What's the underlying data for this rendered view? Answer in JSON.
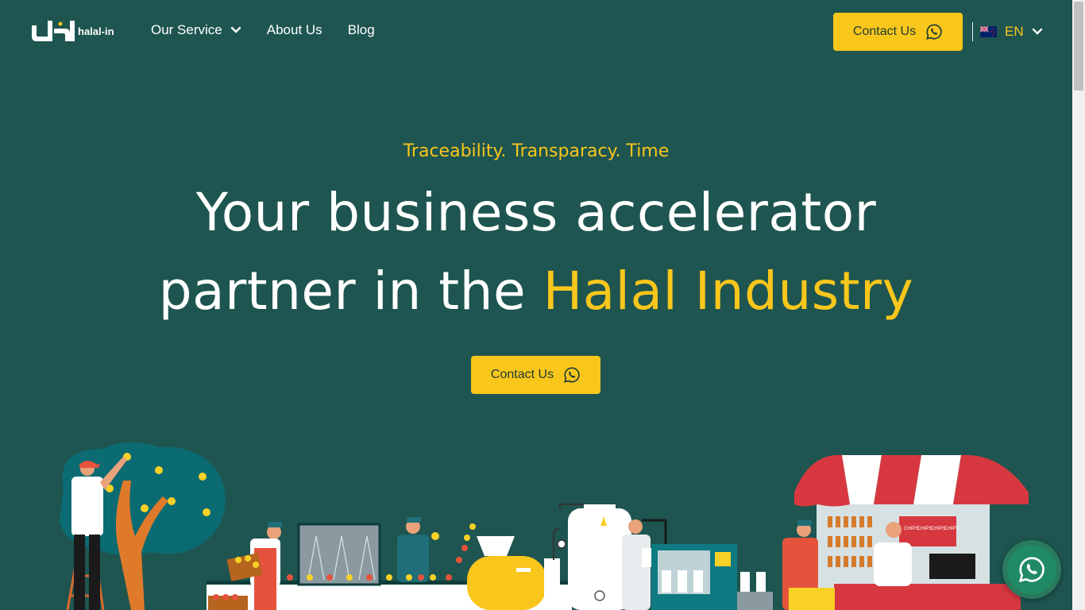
{
  "header": {
    "logo_text": "halal-in",
    "nav": {
      "service": "Our Service",
      "about": "About Us",
      "blog": "Blog"
    },
    "contact_label": "Contact Us",
    "language": "EN"
  },
  "hero": {
    "tagline": "Traceability. Transparacy. Time",
    "headline_line1": "Your business accelerator",
    "headline_line2_prefix": "partner in the ",
    "headline_line2_highlight": "Halal Industry",
    "contact_label": "Contact Us"
  },
  "illustration": {
    "chips_labels": [
      "CHIPS",
      "CHIPS",
      "CHIPS",
      "CHIPS"
    ]
  },
  "icons": {
    "whatsapp": "whatsapp-icon",
    "chevron": "chevron-down-icon",
    "flag": "nz-flag-icon"
  },
  "colors": {
    "background": "#1e5550",
    "accent": "#f9c61b",
    "button_text": "#1e3b36"
  }
}
